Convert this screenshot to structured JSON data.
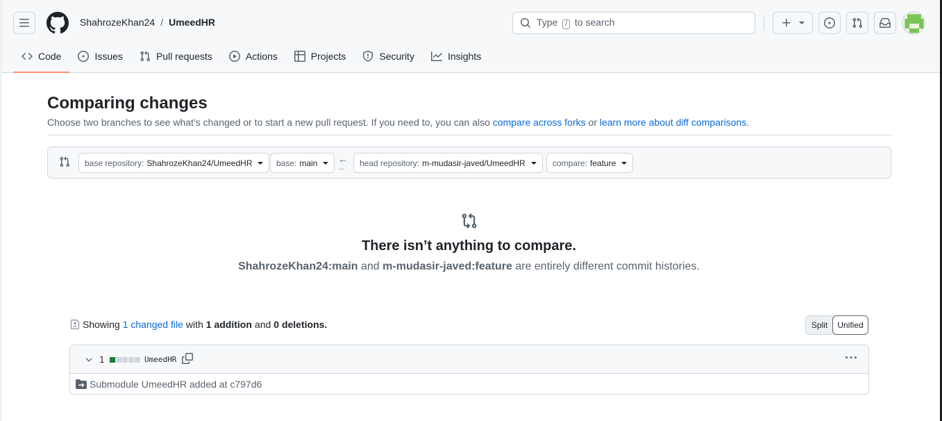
{
  "header": {
    "owner": "ShahrozeKhan24",
    "separator": "/",
    "repo": "UmeedHR",
    "search": {
      "before": "Type",
      "key": "/",
      "after": "to search"
    }
  },
  "tabs": [
    {
      "label": "Code",
      "icon": "code-icon",
      "active": true
    },
    {
      "label": "Issues",
      "icon": "issue-icon"
    },
    {
      "label": "Pull requests",
      "icon": "pull-request-icon"
    },
    {
      "label": "Actions",
      "icon": "play-icon"
    },
    {
      "label": "Projects",
      "icon": "table-icon"
    },
    {
      "label": "Security",
      "icon": "shield-icon"
    },
    {
      "label": "Insights",
      "icon": "graph-icon"
    }
  ],
  "main": {
    "title": "Comparing changes",
    "subtitle_prefix": "Choose two branches to see what’s changed or to start a new pull request. If you need to, you can also ",
    "link_forks": "compare across forks",
    "subtitle_mid": " or ",
    "link_learn": "learn more about diff comparisons",
    "subtitle_end": "."
  },
  "range": {
    "base_repo_label": "base repository:",
    "base_repo_value": "ShahrozeKhan24/UmeedHR",
    "base_label": "base:",
    "base_value": "main",
    "arrow": "←",
    "dots": "...",
    "head_repo_label": "head repository:",
    "head_repo_value": "m-mudasir-javed/UmeedHR",
    "compare_label": "compare:",
    "compare_value": "feature"
  },
  "blank": {
    "title": "There isn’t anything to compare.",
    "base_ref": "ShahrozeKhan24:main",
    "and": " and ",
    "head_ref": "m-mudasir-javed:feature",
    "rest": " are entirely different commit histories."
  },
  "summary": {
    "showing": "Showing",
    "changed_link": "1 changed file",
    "with": "with",
    "additions": "1 addition",
    "and": "and",
    "deletions": "0 deletions."
  },
  "view_toggle": {
    "split": "Split",
    "unified": "Unified",
    "selected": "Unified"
  },
  "file": {
    "count": "1",
    "name": "UmeedHR",
    "diffstat": {
      "added": 1,
      "neutral": 4
    },
    "body": "Submodule UmeedHR added at c797d6"
  },
  "colors": {
    "accent": "#0969da",
    "tab_underline": "#fd8c73",
    "addition": "#1a7f37"
  }
}
